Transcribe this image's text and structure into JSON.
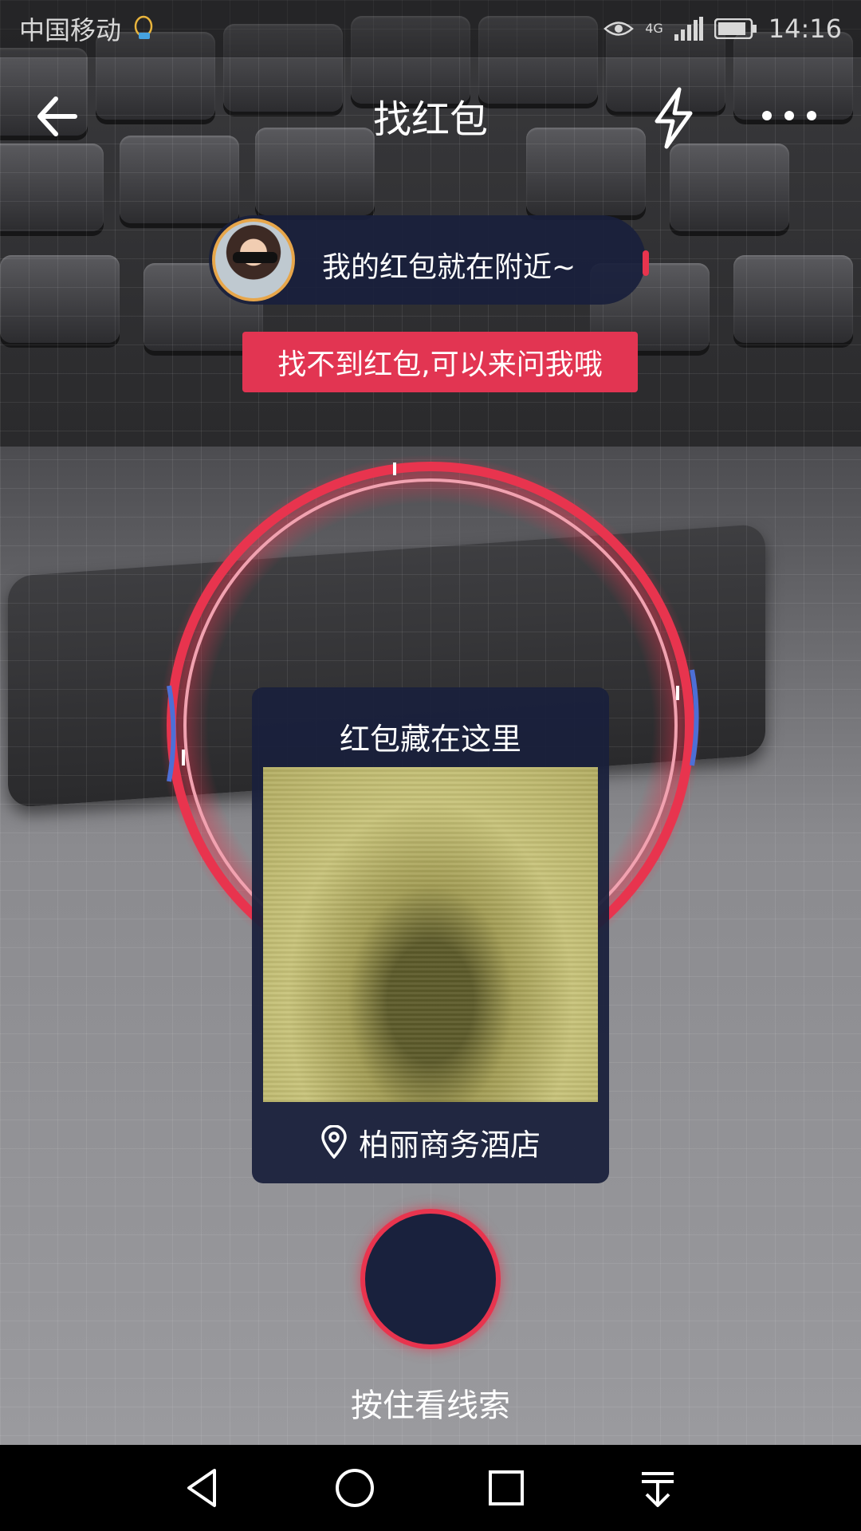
{
  "status_bar": {
    "carrier": "中国移动",
    "network": "4G",
    "time": "14:16"
  },
  "nav": {
    "title": "找红包",
    "icons": [
      "back-arrow-icon",
      "flash-icon",
      "more-icon"
    ]
  },
  "hint": {
    "text": "我的红包就在附近~",
    "ask_banner": "找不到红包,可以来问我哦"
  },
  "clue_card": {
    "title": "红包藏在这里",
    "location": "柏丽商务酒店",
    "location_icon": "location-pin-icon"
  },
  "hold_button": {
    "label": "按住看线索"
  },
  "system_nav": {
    "icons": [
      "back-triangle-icon",
      "home-circle-icon",
      "recents-square-icon",
      "notification-pull-icon"
    ]
  },
  "colors": {
    "accent_red": "#e8344e",
    "card_navy": "#19203c",
    "avatar_ring": "#e7a64a"
  }
}
